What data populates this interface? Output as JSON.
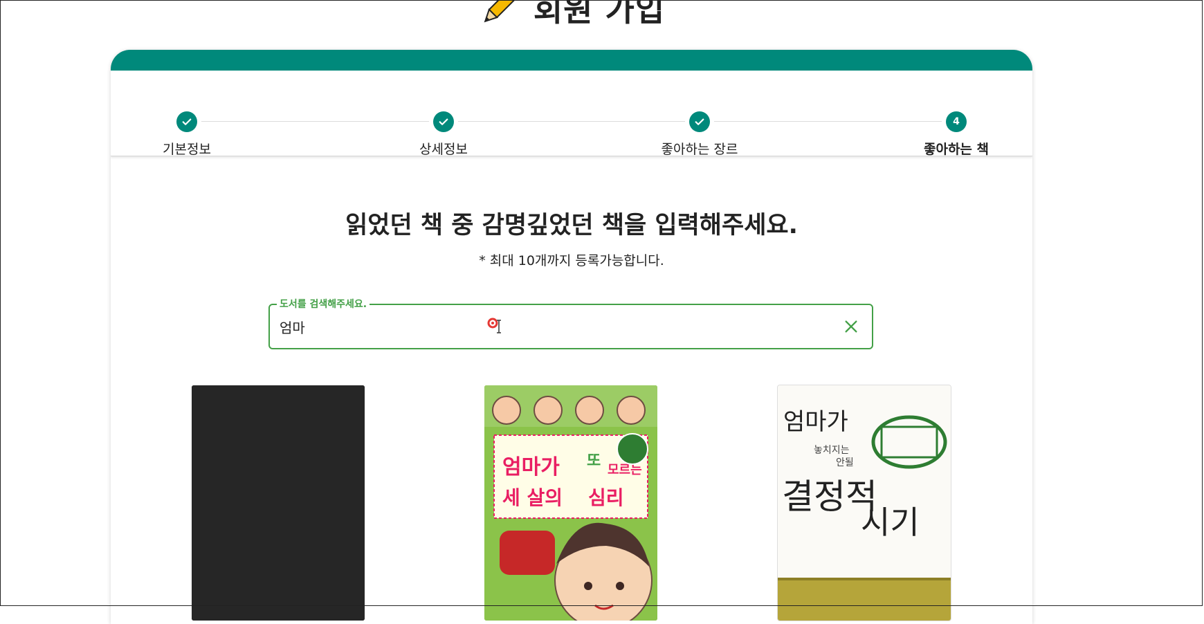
{
  "page": {
    "title": "회원 가입"
  },
  "stepper": {
    "steps": [
      {
        "label": "기본정보",
        "state": "done"
      },
      {
        "label": "상세정보",
        "state": "done"
      },
      {
        "label": "좋아하는 장르",
        "state": "done"
      },
      {
        "label": "좋아하는 책",
        "state": "active",
        "number": "4"
      }
    ]
  },
  "content": {
    "headline": "읽었던 책 중 감명깊었던 책을 입력해주세요.",
    "note": "* 최대 10개까지 등록가능합니다."
  },
  "search": {
    "label": "도서를 검색해주세요.",
    "value": "엄마",
    "clear_icon": "close-icon"
  },
  "books": [
    {
      "cover": "blank-dark-cover"
    },
    {
      "cover_text": [
        "엄마가",
        "또",
        "모르는",
        "세 살의",
        "심리"
      ]
    },
    {
      "cover_text": [
        "엄마가",
        "놓치지는",
        "안될",
        "결정적",
        "시기"
      ]
    }
  ],
  "colors": {
    "brand": "#00897b",
    "field_focus": "#43a047",
    "text": "#222222"
  }
}
